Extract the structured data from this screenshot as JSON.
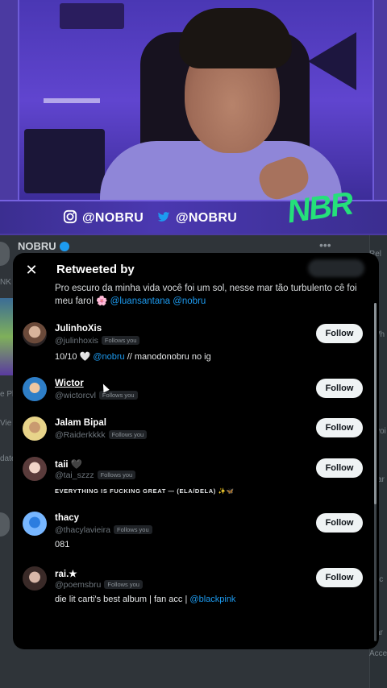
{
  "stream": {
    "instagram_handle": "@NOBRU",
    "twitter_handle": "@NOBRU",
    "logo_text": "NBR"
  },
  "background": {
    "author_name": "NOBRU",
    "more_icon": "more-horizontal-icon",
    "edge_texts": [
      "NK",
      "Rel",
      "Vie",
      "e Pl",
      "date",
      "Wh",
      "yoi",
      "ar",
      "ic",
      "ar",
      "Acce"
    ]
  },
  "modal": {
    "close_icon": "close-icon",
    "title": "Retweeted by",
    "tweet_text": "Pro escuro da minha vida você foi um sol, nesse mar tão turbulento cê foi meu farol",
    "tweet_emoji": "🌸",
    "tweet_mentions": "@luansantana @nobru",
    "users": [
      {
        "name": "JulinhoXis",
        "handle": "@julinhoxis",
        "follows_you": "Follows you",
        "bio": "10/10 🤍",
        "bio_mention": "@nobru",
        "bio_rest": "// manodonobru no ig",
        "button": "Follow"
      },
      {
        "name": "Wictor",
        "handle": "@wictorcvl",
        "follows_you": "Follows you",
        "bio": "",
        "button": "Follow"
      },
      {
        "name": "Jalam Bipal",
        "handle": "@Raiderkkkk",
        "follows_you": "Follows you",
        "bio": "",
        "button": "Follow"
      },
      {
        "name": "taii 🖤",
        "handle": "@tai_szzz",
        "follows_you": "Follows you",
        "bio": "EVERYTHING IS FUCKING GREAT — (ELA/DELA) ✨🦋",
        "button": "Follow"
      },
      {
        "name": "thacy",
        "handle": "@thacylavieira",
        "follows_you": "Follows you",
        "bio": "081",
        "button": "Follow"
      },
      {
        "name": "rai.★",
        "handle": "@poemsbru",
        "follows_you": "Follows you",
        "bio": "die lit carti's best album | fan acc |",
        "bio_mention": "@blackpink",
        "button": "Follow"
      }
    ]
  },
  "colors": {
    "accent": "#1d9bf0",
    "modal_bg": "#000000",
    "button_bg": "#eff3f4",
    "stream_purple": "#4b3aa1",
    "logo_green": "#25e07a"
  }
}
